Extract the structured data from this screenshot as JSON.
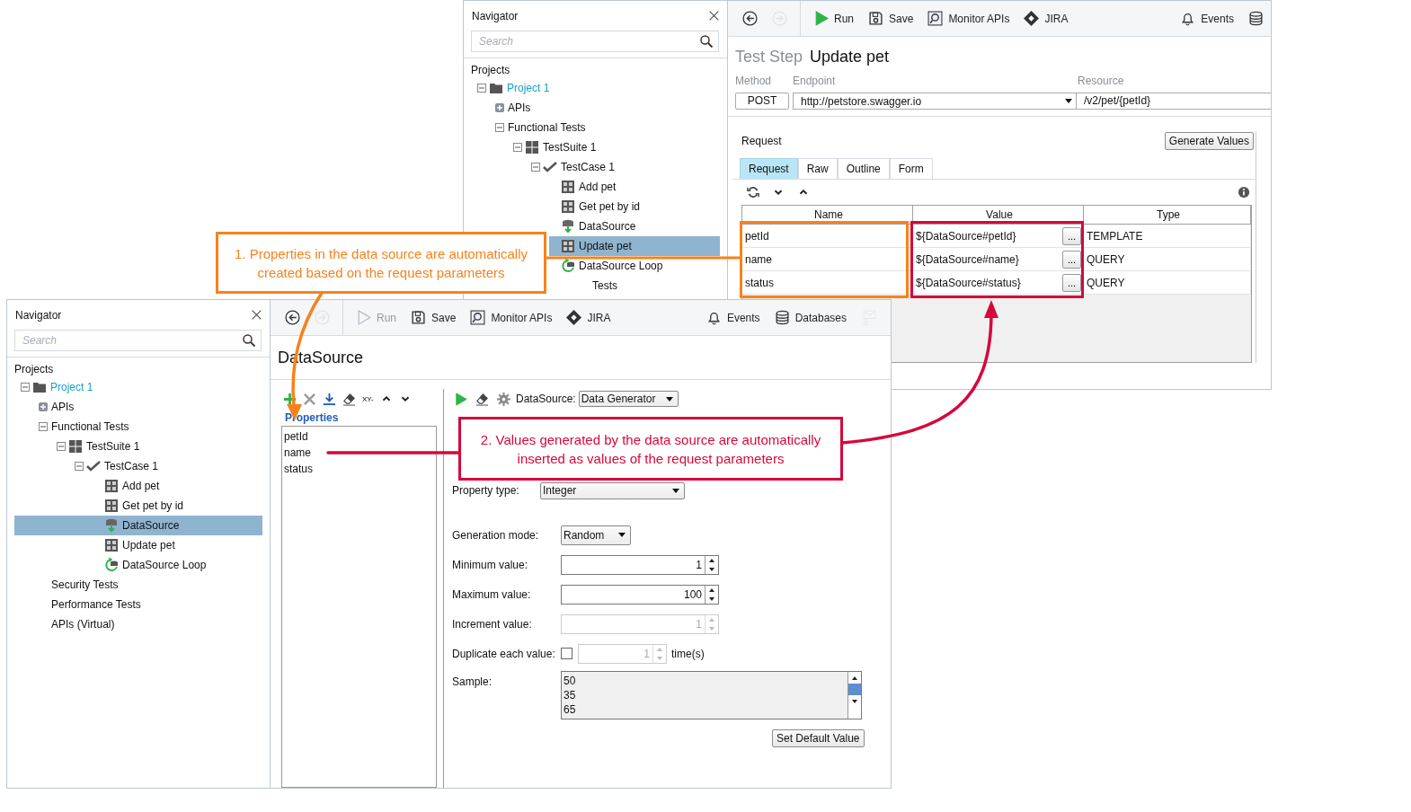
{
  "back_window": {
    "navigator": {
      "title": "Navigator",
      "search_placeholder": "Search",
      "section": "Projects",
      "tree": [
        {
          "label": "Project 1",
          "kind": "project",
          "expanded": true,
          "selected": false,
          "children": [
            {
              "label": "APIs",
              "expanded": false,
              "selected": false
            },
            {
              "label": "Functional Tests",
              "expanded": true,
              "selected": false,
              "children": [
                {
                  "label": "TestSuite 1",
                  "kind": "suite",
                  "expanded": true,
                  "selected": false,
                  "children": [
                    {
                      "label": "TestCase 1",
                      "kind": "case",
                      "expanded": true,
                      "selected": false,
                      "children": [
                        {
                          "label": "Add pet",
                          "kind": "rest",
                          "selected": false
                        },
                        {
                          "label": "Get pet by id",
                          "kind": "rest",
                          "selected": false
                        },
                        {
                          "label": "DataSource",
                          "kind": "datasource",
                          "selected": false
                        },
                        {
                          "label": "Update pet",
                          "kind": "rest",
                          "selected": true
                        },
                        {
                          "label": "DataSource Loop",
                          "kind": "loop",
                          "selected": false
                        }
                      ]
                    }
                  ]
                }
              ]
            },
            {
              "label": "Tests",
              "kind": "partial",
              "selected": false
            }
          ]
        }
      ]
    },
    "toolbar_left": [
      {
        "kind": "back",
        "disabled": false
      },
      {
        "kind": "forward",
        "disabled": true
      },
      {
        "kind": "run",
        "label": "Run",
        "disabled": false
      },
      {
        "kind": "save",
        "label": "Save",
        "disabled": false
      },
      {
        "kind": "monitor",
        "label": "Monitor APIs",
        "disabled": false
      },
      {
        "kind": "jira",
        "label": "JIRA",
        "disabled": false
      }
    ],
    "toolbar_right": [
      {
        "kind": "events",
        "label": "Events",
        "disabled": false
      },
      {
        "kind": "database",
        "disabled": false
      }
    ],
    "step": {
      "kind_label": "Test Step",
      "name": "Update pet"
    },
    "fields": {
      "method_label": "Method",
      "endpoint_label": "Endpoint",
      "resource_label": "Resource",
      "method": "POST",
      "endpoint": "http://petstore.swagger.io",
      "resource": "/v2/pet/{petId}"
    },
    "request": {
      "label": "Request",
      "generate_button": "Generate Values",
      "tabs": [
        {
          "label": "Request",
          "selected": true
        },
        {
          "label": "Raw",
          "selected": false
        },
        {
          "label": "Outline",
          "selected": false
        },
        {
          "label": "Form",
          "selected": false
        }
      ],
      "columns": [
        "Name",
        "Value",
        "Type"
      ],
      "rows": [
        {
          "name": "petId",
          "value": "${DataSource#petId}",
          "type": "TEMPLATE"
        },
        {
          "name": "name",
          "value": "${DataSource#name}",
          "type": "QUERY"
        },
        {
          "name": "status",
          "value": "${DataSource#status}",
          "type": "QUERY"
        }
      ],
      "edit_button": "..."
    }
  },
  "front_window": {
    "navigator": {
      "title": "Navigator",
      "search_placeholder": "Search",
      "section": "Projects",
      "tree": [
        {
          "label": "Project 1",
          "kind": "project",
          "expanded": true,
          "selected": false,
          "children": [
            {
              "label": "APIs",
              "expanded": false,
              "selected": false
            },
            {
              "label": "Functional Tests",
              "expanded": true,
              "selected": false,
              "children": [
                {
                  "label": "TestSuite 1",
                  "kind": "suite",
                  "expanded": true,
                  "selected": false,
                  "children": [
                    {
                      "label": "TestCase 1",
                      "kind": "case",
                      "expanded": true,
                      "selected": false,
                      "children": [
                        {
                          "label": "Add pet",
                          "kind": "rest",
                          "selected": false
                        },
                        {
                          "label": "Get pet by id",
                          "kind": "rest",
                          "selected": false
                        },
                        {
                          "label": "DataSource",
                          "kind": "datasource",
                          "selected": true
                        },
                        {
                          "label": "Update pet",
                          "kind": "rest",
                          "selected": false
                        },
                        {
                          "label": "DataSource Loop",
                          "kind": "loop",
                          "selected": false
                        }
                      ]
                    }
                  ]
                }
              ]
            },
            {
              "label": "Security Tests",
              "selected": false
            },
            {
              "label": "Performance Tests",
              "selected": false
            },
            {
              "label": "APIs (Virtual)",
              "selected": false
            }
          ]
        }
      ]
    },
    "toolbar_left": [
      {
        "kind": "back",
        "disabled": false
      },
      {
        "kind": "forward",
        "disabled": true
      },
      {
        "kind": "run",
        "label": "Run",
        "disabled": true
      },
      {
        "kind": "save",
        "label": "Save",
        "disabled": false
      },
      {
        "kind": "monitor",
        "label": "Monitor APIs",
        "disabled": false
      },
      {
        "kind": "jira",
        "label": "JIRA",
        "disabled": false
      }
    ],
    "toolbar_right": [
      {
        "kind": "events",
        "label": "Events",
        "disabled": false
      },
      {
        "kind": "database",
        "label": "Databases",
        "disabled": false
      },
      {
        "kind": "mail",
        "disabled": true
      }
    ],
    "title": "DataSource",
    "properties": {
      "toolbar": [
        {
          "kind": "add"
        },
        {
          "kind": "delete"
        },
        {
          "kind": "download"
        },
        {
          "kind": "eraser"
        },
        {
          "kind": "text",
          "label": "XY-"
        },
        {
          "kind": "up"
        },
        {
          "kind": "down"
        }
      ],
      "label": "Properties",
      "items": [
        "petId",
        "name",
        "status"
      ]
    },
    "source_toolbar": [
      {
        "kind": "run"
      },
      {
        "kind": "eraser"
      },
      {
        "kind": "gear"
      }
    ],
    "source": {
      "label": "DataSource:",
      "value": "Data Generator"
    },
    "form": [
      {
        "kind": "select",
        "label": "Property type:",
        "value": "Integer"
      },
      {
        "kind": "select",
        "label": "Generation mode:",
        "value": "Random"
      },
      {
        "kind": "spin",
        "label": "Minimum value:",
        "value": "1",
        "disabled": false
      },
      {
        "kind": "spin",
        "label": "Maximum value:",
        "value": "100",
        "disabled": false
      },
      {
        "kind": "spin",
        "label": "Increment value:",
        "value": "1",
        "disabled": true
      },
      {
        "kind": "duplicate",
        "label": "Duplicate each value:",
        "checked": false,
        "value": "1",
        "disabled": true,
        "unit": "time(s)"
      },
      {
        "kind": "sample",
        "label": "Sample:",
        "lines": [
          "50",
          "35",
          "65"
        ]
      }
    ],
    "default_button": "Set Default Value"
  },
  "callouts": [
    {
      "text": "1. Properties in the data source are automatically created based on the request parameters",
      "color": "#f7821b"
    },
    {
      "text": "2. Values generated by the data source are automatically inserted as values of the request parameters",
      "color": "#d6083b"
    }
  ]
}
